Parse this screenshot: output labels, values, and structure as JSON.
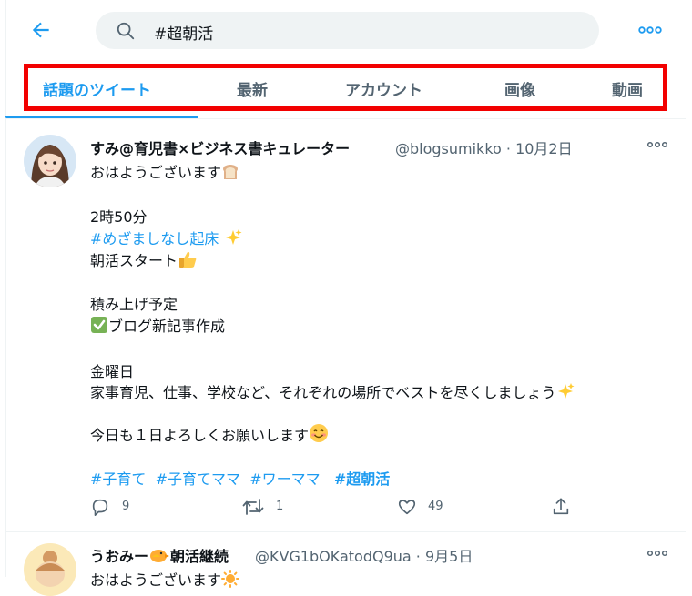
{
  "search": {
    "query": "#超朝活"
  },
  "tabs": [
    "話題のツイート",
    "最新",
    "アカウント",
    "画像",
    "動画"
  ],
  "tweets": [
    {
      "name": "すみ@育児書×ビジネス書キュレーター",
      "handle": "@blogsumikko · 10月2日",
      "lines": {
        "l1": "おはようございます",
        "l2": "2時50分",
        "l3": "#めざましなし起床",
        "l4": "朝活スタート",
        "l5": "積み上げ予定",
        "l6": "ブログ新記事作成",
        "l7": "金曜日",
        "l8": "家事育児、仕事、学校など、それぞれの場所でベストを尽くしましょう",
        "l9": "今日も１日よろしくお願いします"
      },
      "hashtags": [
        "#子育て",
        "#子育てママ",
        "#ワーママ",
        "#超朝活"
      ],
      "replies": "9",
      "retweets": "1",
      "likes": "49"
    },
    {
      "name": "うおみー",
      "name_suffix": "朝活継続",
      "handle": "@KVG1bOKatodQ9ua · 9月5日",
      "first_line": "おはようございます"
    }
  ]
}
